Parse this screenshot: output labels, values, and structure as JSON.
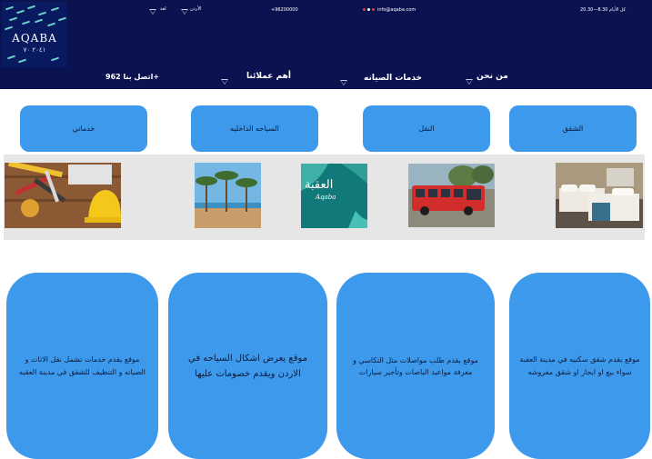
{
  "header": {
    "logo": {
      "title": "AQABA",
      "subtitle": "٢٠٤١ ٧٠"
    },
    "top_bar": {
      "hours": "كل الأيام 8.30—20.30",
      "email": "info@aqaba.com",
      "phone": "+96200000",
      "country": "الأردن",
      "language": "لغة"
    },
    "nav": {
      "about": "من نحن",
      "maintenance": "خدمات الصيانه",
      "clients": "أهم عملائنا",
      "contact": "اتصل بنا 962+"
    },
    "colors": {
      "navy": "#0b1250",
      "accent_blue": "#3d99ec"
    }
  },
  "categories": [
    "الشقق",
    "النقل",
    "السياحه الداخليه",
    "خدماتي"
  ],
  "gallery": [
    {
      "name": "bedroom-photo"
    },
    {
      "name": "tour-bus-photo"
    },
    {
      "name": "aqaba-sea-photo",
      "caption": "العقبة",
      "caption_latin": "Aqaba"
    },
    {
      "name": "palm-beach-photo"
    },
    {
      "name": "tools-photo"
    }
  ],
  "cards": [
    "موقع يقدم شقق سكنيه في مدينة العقبة سواء بيع او ايجار او شقق مفروشه",
    "موقع يقدم طلب مواصلات مثل التكاسي و معرفة مواعيد الباصات وتأجير سيارات",
    "موقع يعرض اشكال السياحه في الاردن ويقدم خصومات عليها",
    "موقع يقدم خدمات تشمل نقل الاثاث و الصيانه و التنظيف للشقق في مدينة العقبه"
  ]
}
